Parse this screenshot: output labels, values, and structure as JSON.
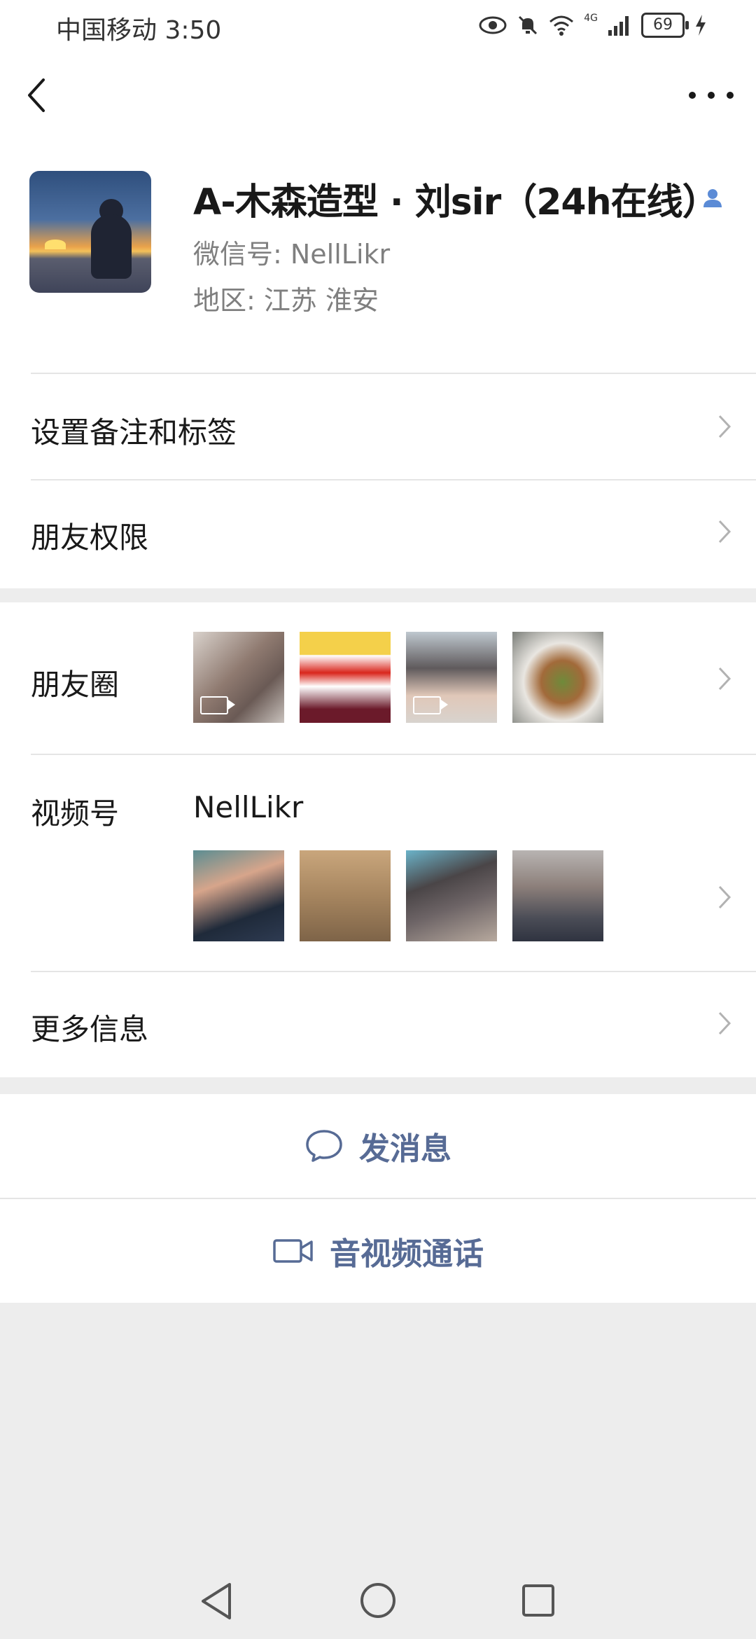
{
  "status_bar": {
    "carrier_time": "中国移动 3:50",
    "network": "4G",
    "battery": "69"
  },
  "profile": {
    "name": "A-木森造型 · 刘sir（24h在线）",
    "wechat_id": "微信号:  NellLikr",
    "region": "地区:  江苏  淮安"
  },
  "menu": {
    "remark_tags": "设置备注和标签",
    "friend_permissions": "朋友权限",
    "moments": "朋友圈",
    "channels": "视频号",
    "channels_name": "NellLikr",
    "more_info": "更多信息"
  },
  "actions": {
    "send_message": "发消息",
    "video_call": "音视频通话"
  },
  "colors": {
    "link_blue": "#576b95",
    "background": "#ededed",
    "accent_contact_icon": "#5b8bd6"
  },
  "icons": [
    "back-icon",
    "more-icon",
    "contact-icon",
    "chevron-right-icon",
    "chat-bubble-icon",
    "video-camera-icon",
    "nav-back-icon",
    "nav-home-icon",
    "nav-recent-icon"
  ]
}
